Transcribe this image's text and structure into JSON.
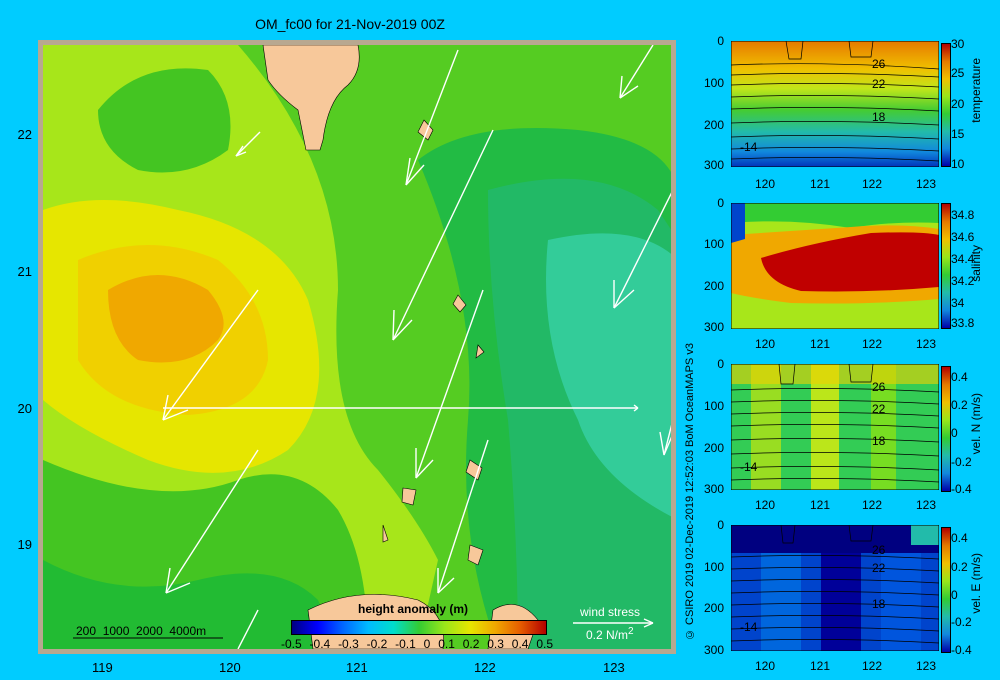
{
  "title": "OM_fc00 for 21-Nov-2019 00Z",
  "main_map": {
    "x_ticks": [
      "119",
      "120",
      "121",
      "122",
      "123"
    ],
    "y_ticks": [
      "22",
      "21",
      "20",
      "19"
    ],
    "depth_scale": "200  1000  2000  4000m",
    "colorbar": {
      "label": "height anomaly (m)",
      "ticks": [
        "-0.5",
        "-0.4",
        "-0.3",
        "-0.2",
        "-0.1",
        "0",
        "0.1",
        "0.2",
        "0.3",
        "0.4",
        "0.5"
      ]
    },
    "wind_stress": {
      "label": "wind stress",
      "value": "0.2 N/m",
      "superscript": "2"
    }
  },
  "side_panels": [
    {
      "variable": "temperature",
      "y_ticks": [
        "0",
        "100",
        "200",
        "300"
      ],
      "x_ticks": [
        "120",
        "121",
        "122",
        "123"
      ],
      "colorbar_ticks": [
        "30",
        "25",
        "20",
        "15",
        "10"
      ],
      "contour_labels": [
        "26",
        "22",
        "18",
        "-14"
      ]
    },
    {
      "variable": "salinity",
      "y_ticks": [
        "0",
        "100",
        "200",
        "300"
      ],
      "x_ticks": [
        "120",
        "121",
        "122",
        "123"
      ],
      "colorbar_ticks": [
        "34.8",
        "34.6",
        "34.4",
        "34.2",
        "34",
        "33.8"
      ],
      "contour_labels": []
    },
    {
      "variable": "vel. N (m/s)",
      "y_ticks": [
        "0",
        "100",
        "200",
        "300"
      ],
      "x_ticks": [
        "120",
        "121",
        "122",
        "123"
      ],
      "colorbar_ticks": [
        "0.4",
        "0.2",
        "0",
        "-0.2",
        "-0.4"
      ],
      "contour_labels": [
        "26",
        "22",
        "18",
        "-14"
      ]
    },
    {
      "variable": "vel. E (m/s)",
      "y_ticks": [
        "0",
        "100",
        "200",
        "300"
      ],
      "x_ticks": [
        "120",
        "121",
        "122",
        "123"
      ],
      "colorbar_ticks": [
        "0.4",
        "0.2",
        "0",
        "-0.2",
        "-0.4"
      ],
      "contour_labels": [
        "26",
        "22",
        "18",
        "-14"
      ]
    }
  ],
  "credit": "© CSIRO 2019   02-Dec-2019 12:52:03 BoM OceanMAPS v3"
}
